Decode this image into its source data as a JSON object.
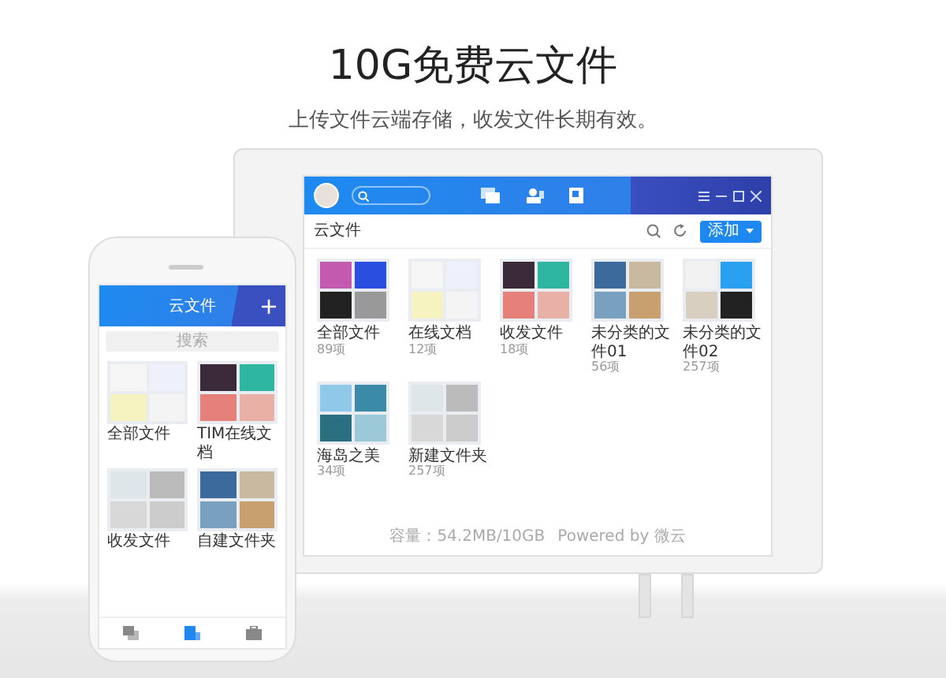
{
  "heading": {
    "title": "10G免费云文件",
    "subtitle": "上传文件云端存储，收发文件长期有效。"
  },
  "desktop_app": {
    "page_title": "云文件",
    "add_button": "添加",
    "folders": [
      {
        "name": "全部文件",
        "count": "89项"
      },
      {
        "name": "在线文档",
        "count": "12项"
      },
      {
        "name": "收发文件",
        "count": "18项"
      },
      {
        "name": "未分类的文件01",
        "count": "56项"
      },
      {
        "name": "未分类的文件02",
        "count": "257项"
      },
      {
        "name": "海岛之美",
        "count": "34项"
      },
      {
        "name": "新建文件夹",
        "count": "257项"
      }
    ],
    "footer": "容量：54.2MB/10GB",
    "footer_credit": "Powered by 微云"
  },
  "phone_app": {
    "title": "云文件",
    "search_placeholder": "搜索",
    "folders": [
      {
        "name": "全部文件"
      },
      {
        "name": "TIM在线文档"
      },
      {
        "name": "收发文件"
      },
      {
        "name": "自建文件夹"
      }
    ],
    "tabs": [
      {
        "selected": false
      },
      {
        "selected": true
      },
      {
        "selected": false
      }
    ]
  }
}
